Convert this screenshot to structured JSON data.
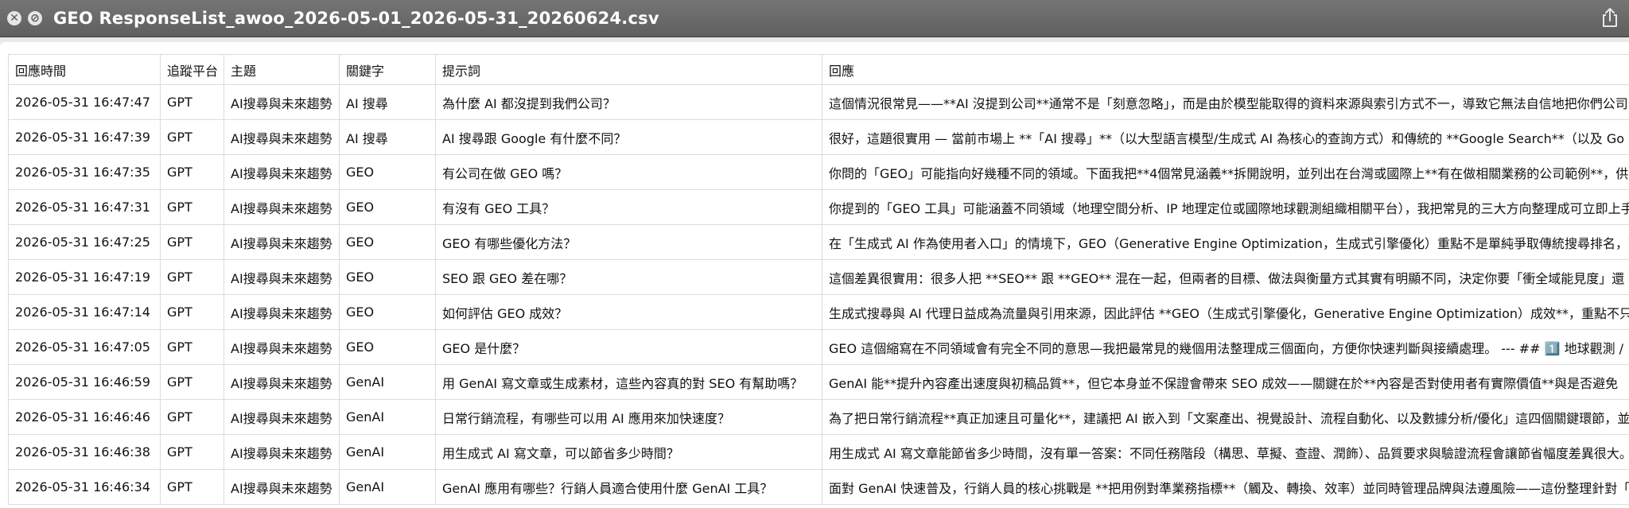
{
  "window": {
    "title": "GEO ResponseList_awoo_2026-05-01_2026-05-31_20260624.csv",
    "close_symbol": "✕",
    "fullscreen_symbol": "⊘"
  },
  "table": {
    "headers": [
      "回應時間",
      "追蹤平台",
      "主題",
      "關鍵字",
      "提示詞",
      "回應"
    ],
    "rows": [
      [
        "2026-05-31 16:47:47",
        "GPT",
        "AI搜尋與未來趨勢",
        "AI 搜尋",
        "為什麼 AI 都沒提到我們公司？",
        "這個情況很常見——**AI 沒提到公司**通常不是「刻意忽略」，而是由於模型能取得的資料來源與索引方式不一，導致它無法自信地把你們公司"
      ],
      [
        "2026-05-31 16:47:39",
        "GPT",
        "AI搜尋與未來趨勢",
        "AI 搜尋",
        "AI 搜尋跟 Google 有什麼不同？",
        "很好，這題很實用 — 當前市場上 **「AI 搜尋」**（以大型語言模型/生成式 AI 為核心的查詢方式）和傳統的 **Google Search**（以及 Go"
      ],
      [
        "2026-05-31 16:47:35",
        "GPT",
        "AI搜尋與未來趨勢",
        "GEO",
        "有公司在做 GEO 嗎？",
        "你問的「GEO」可能指向好幾種不同的領域。下面我把**4個常見涵義**拆開說明，並列出在台灣或國際上**有在做相關業務的公司範例**，供"
      ],
      [
        "2026-05-31 16:47:31",
        "GPT",
        "AI搜尋與未來趨勢",
        "GEO",
        "有沒有 GEO 工具？",
        "你提到的「GEO 工具」可能涵蓋不同領域（地理空間分析、IP 地理定位或國際地球觀測組織相關平台），我把常見的三大方向整理成可立即上手"
      ],
      [
        "2026-05-31 16:47:25",
        "GPT",
        "AI搜尋與未來趨勢",
        "GEO",
        "GEO 有哪些優化方法？",
        "在「生成式 AI 作為使用者入口」的情境下，GEO（Generative Engine Optimization，生成式引擎優化）重點不是單純爭取傳統搜尋排名，而"
      ],
      [
        "2026-05-31 16:47:19",
        "GPT",
        "AI搜尋與未來趨勢",
        "GEO",
        "SEO 跟 GEO 差在哪？",
        "這個差異很實用：很多人把 **SEO** 跟 **GEO** 混在一起，但兩者的目標、做法與衡量方式其實有明顯不同，決定你要「衝全域能見度」還"
      ],
      [
        "2026-05-31 16:47:14",
        "GPT",
        "AI搜尋與未來趨勢",
        "GEO",
        "如何評估 GEO 成效？",
        "生成式搜尋與 AI 代理日益成為流量與引用來源，因此評估 **GEO（生成式引擎優化，Generative Engine Optimization）成效**，重點不只在"
      ],
      [
        "2026-05-31 16:47:05",
        "GPT",
        "AI搜尋與未來趨勢",
        "GEO",
        "GEO 是什麼？",
        "GEO 這個縮寫在不同領域會有完全不同的意思—我把最常見的幾個用法整理成三個面向，方便你快速判斷與接續處理。    --- ## 1️⃣ 地球觀測 /"
      ],
      [
        "2026-05-31 16:46:59",
        "GPT",
        "AI搜尋與未來趨勢",
        "GenAI",
        "用 GenAI 寫文章或生成素材，這些內容真的對 SEO 有幫助嗎？",
        "GenAI 能**提升內容產出速度與初稿品質**，但它本身並不保證會帶來 SEO 成效——關鍵在於**內容是否對使用者有實際價值**與是否避免"
      ],
      [
        "2026-05-31 16:46:46",
        "GPT",
        "AI搜尋與未來趨勢",
        "GenAI",
        "日常行銷流程，有哪些可以用 AI 應用來加快速度？",
        "為了把日常行銷流程**真正加速且可量化**，建議把 AI 嵌入到「文案產出、視覺設計、流程自動化、以及數據分析/優化」這四個關鍵環節，並"
      ],
      [
        "2026-05-31 16:46:38",
        "GPT",
        "AI搜尋與未來趨勢",
        "GenAI",
        "用生成式 AI 寫文章，可以節省多少時間？",
        "用生成式 AI 寫文章能節省多少時間，沒有單一答案：不同任務階段（構思、草擬、查證、潤飾）、品質要求與驗證流程會讓節省幅度差異很大。"
      ],
      [
        "2026-05-31 16:46:34",
        "GPT",
        "AI搜尋與未來趨勢",
        "GenAI",
        "GenAI 應用有哪些？行銷人員適合使用什麼 GenAI 工具？",
        "面對 GenAI 快速普及，行銷人員的核心挑戰是 **把用例對準業務指標**（觸及、轉換、效率）並同時管理品牌與法遵風險——這份整理針對「"
      ]
    ]
  }
}
